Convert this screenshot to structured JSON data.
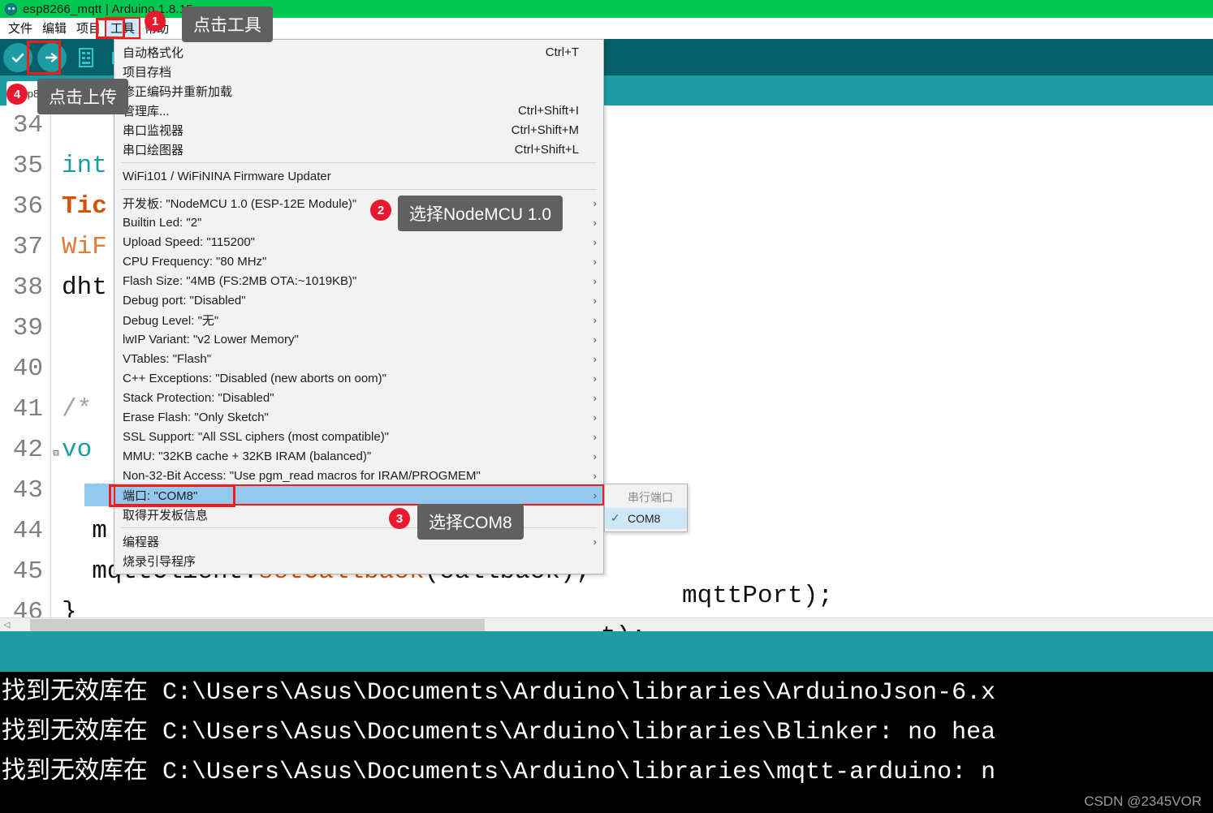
{
  "window": {
    "title": "esp8266_mqtt | Arduino 1.8.15",
    "icon": "arduino-infinity-icon"
  },
  "menubar": {
    "items": [
      {
        "label": "文件",
        "active": false
      },
      {
        "label": "编辑",
        "active": false
      },
      {
        "label": "项目",
        "active": false
      },
      {
        "label": "工具",
        "active": true
      },
      {
        "label": "帮助",
        "active": false
      }
    ]
  },
  "toolbar": {
    "buttons": [
      {
        "name": "verify-button",
        "icon": "check-icon"
      },
      {
        "name": "upload-button",
        "icon": "arrow-right-icon"
      },
      {
        "name": "new-button",
        "icon": "new-file-icon"
      },
      {
        "name": "open-button",
        "icon": "open-folder-icon"
      }
    ]
  },
  "tabbar": {
    "tabs": [
      {
        "label": "esp8266_mqtt"
      }
    ]
  },
  "editor": {
    "lines": [
      {
        "num": "34",
        "fold": "",
        "tokens": []
      },
      {
        "num": "35",
        "fold": "",
        "tokens": [
          {
            "t": "int",
            "c": "kw"
          }
        ]
      },
      {
        "num": "36",
        "fold": "",
        "tokens": [
          {
            "t": "Tic",
            "c": "typ"
          }
        ]
      },
      {
        "num": "37",
        "fold": "",
        "tokens": [
          {
            "t": "WiF",
            "c": "typ2"
          }
        ]
      },
      {
        "num": "38",
        "fold": "",
        "tokens": [
          {
            "t": "dht",
            "c": "pln"
          }
        ]
      },
      {
        "num": "39",
        "fold": "",
        "tokens": []
      },
      {
        "num": "40",
        "fold": "",
        "tokens": []
      },
      {
        "num": "41",
        "fold": "",
        "tokens": [
          {
            "t": "/*",
            "c": "com"
          }
        ]
      },
      {
        "num": "42",
        "fold": "⊟",
        "tokens": [
          {
            "t": "vo",
            "c": "kw"
          }
        ]
      },
      {
        "num": "43",
        "fold": "",
        "tokens": [
          {
            "t": "  m",
            "c": "pln"
          }
        ]
      },
      {
        "num": "44",
        "fold": "",
        "tokens": [
          {
            "t": "  m",
            "c": "pln"
          }
        ]
      },
      {
        "num": "45",
        "fold": "",
        "tokens": [
          {
            "t": "  mqttClient.",
            "c": "pln"
          },
          {
            "t": "setCallback",
            "c": "fn"
          },
          {
            "t": "(callback);",
            "c": "pln"
          }
        ]
      },
      {
        "num": "46",
        "fold": "",
        "tokens": [
          {
            "t": "}",
            "c": "pln"
          }
        ]
      }
    ],
    "overflow_code": {
      "line43_tail": "mqttPort);",
      "line44_tail": "t);",
      "line45_tail": "ck);"
    }
  },
  "tools_menu": {
    "groups": [
      {
        "items": [
          {
            "label": "自动格式化",
            "accel": "Ctrl+T",
            "arrow": false
          },
          {
            "label": "项目存档",
            "accel": "",
            "arrow": false
          },
          {
            "label": "修正编码并重新加载",
            "accel": "",
            "arrow": false
          },
          {
            "label": "管理库...",
            "accel": "Ctrl+Shift+I",
            "arrow": false
          },
          {
            "label": "串口监视器",
            "accel": "Ctrl+Shift+M",
            "arrow": false
          },
          {
            "label": "串口绘图器",
            "accel": "Ctrl+Shift+L",
            "arrow": false
          }
        ]
      },
      {
        "items": [
          {
            "label": "WiFi101 / WiFiNINA Firmware Updater",
            "accel": "",
            "arrow": false
          }
        ]
      },
      {
        "items": [
          {
            "label": "开发板: \"NodeMCU 1.0 (ESP-12E Module)\"",
            "accel": "",
            "arrow": true
          },
          {
            "label": "Builtin Led: \"2\"",
            "accel": "",
            "arrow": true
          },
          {
            "label": "Upload Speed: \"115200\"",
            "accel": "",
            "arrow": true
          },
          {
            "label": "CPU Frequency: \"80 MHz\"",
            "accel": "",
            "arrow": true
          },
          {
            "label": "Flash Size: \"4MB (FS:2MB OTA:~1019KB)\"",
            "accel": "",
            "arrow": true
          },
          {
            "label": "Debug port: \"Disabled\"",
            "accel": "",
            "arrow": true
          },
          {
            "label": "Debug Level: \"无\"",
            "accel": "",
            "arrow": true
          },
          {
            "label": "lwIP Variant: \"v2 Lower Memory\"",
            "accel": "",
            "arrow": true
          },
          {
            "label": "VTables: \"Flash\"",
            "accel": "",
            "arrow": true
          },
          {
            "label": "C++ Exceptions: \"Disabled (new aborts on oom)\"",
            "accel": "",
            "arrow": true
          },
          {
            "label": "Stack Protection: \"Disabled\"",
            "accel": "",
            "arrow": true
          },
          {
            "label": "Erase Flash: \"Only Sketch\"",
            "accel": "",
            "arrow": true
          },
          {
            "label": "SSL Support: \"All SSL ciphers (most compatible)\"",
            "accel": "",
            "arrow": true
          },
          {
            "label": "MMU: \"32KB cache + 32KB IRAM (balanced)\"",
            "accel": "",
            "arrow": true
          },
          {
            "label": "Non-32-Bit Access: \"Use pgm_read macros for IRAM/PROGMEM\"",
            "accel": "",
            "arrow": true
          },
          {
            "label": "端口: \"COM8\"",
            "accel": "",
            "arrow": true,
            "selected": true,
            "boxed": true
          },
          {
            "label": "取得开发板信息",
            "accel": "",
            "arrow": false
          }
        ]
      },
      {
        "items": [
          {
            "label": "编程器",
            "accel": "",
            "arrow": true
          },
          {
            "label": "烧录引导程序",
            "accel": "",
            "arrow": false
          }
        ]
      }
    ]
  },
  "port_submenu": {
    "header": "串行端口",
    "items": [
      {
        "label": "COM8",
        "checked": true,
        "check_glyph": "✓"
      }
    ]
  },
  "annotations": [
    {
      "badge": "1",
      "text": "点击工具"
    },
    {
      "badge": "2",
      "text": "选择NodeMCU 1.0"
    },
    {
      "badge": "3",
      "text": "选择COM8"
    },
    {
      "badge": "4",
      "text": "点击上传"
    }
  ],
  "console": {
    "lines": [
      "找到无效库在 C:\\Users\\Asus\\Documents\\Arduino\\libraries\\ArduinoJson-6.x",
      "找到无效库在 C:\\Users\\Asus\\Documents\\Arduino\\libraries\\Blinker: no hea",
      "找到无效库在 C:\\Users\\Asus\\Documents\\Arduino\\libraries\\mqtt-arduino: n"
    ]
  },
  "watermark": "CSDN @2345VOR",
  "colors": {
    "title_bar": "#00c853",
    "toolbar": "#055f66",
    "tabbar": "#1d9da3",
    "accent_red": "#ff1818",
    "badge_red": "#e8192c",
    "selection_blue": "#93c9ef",
    "callout_gray": "#606060"
  }
}
